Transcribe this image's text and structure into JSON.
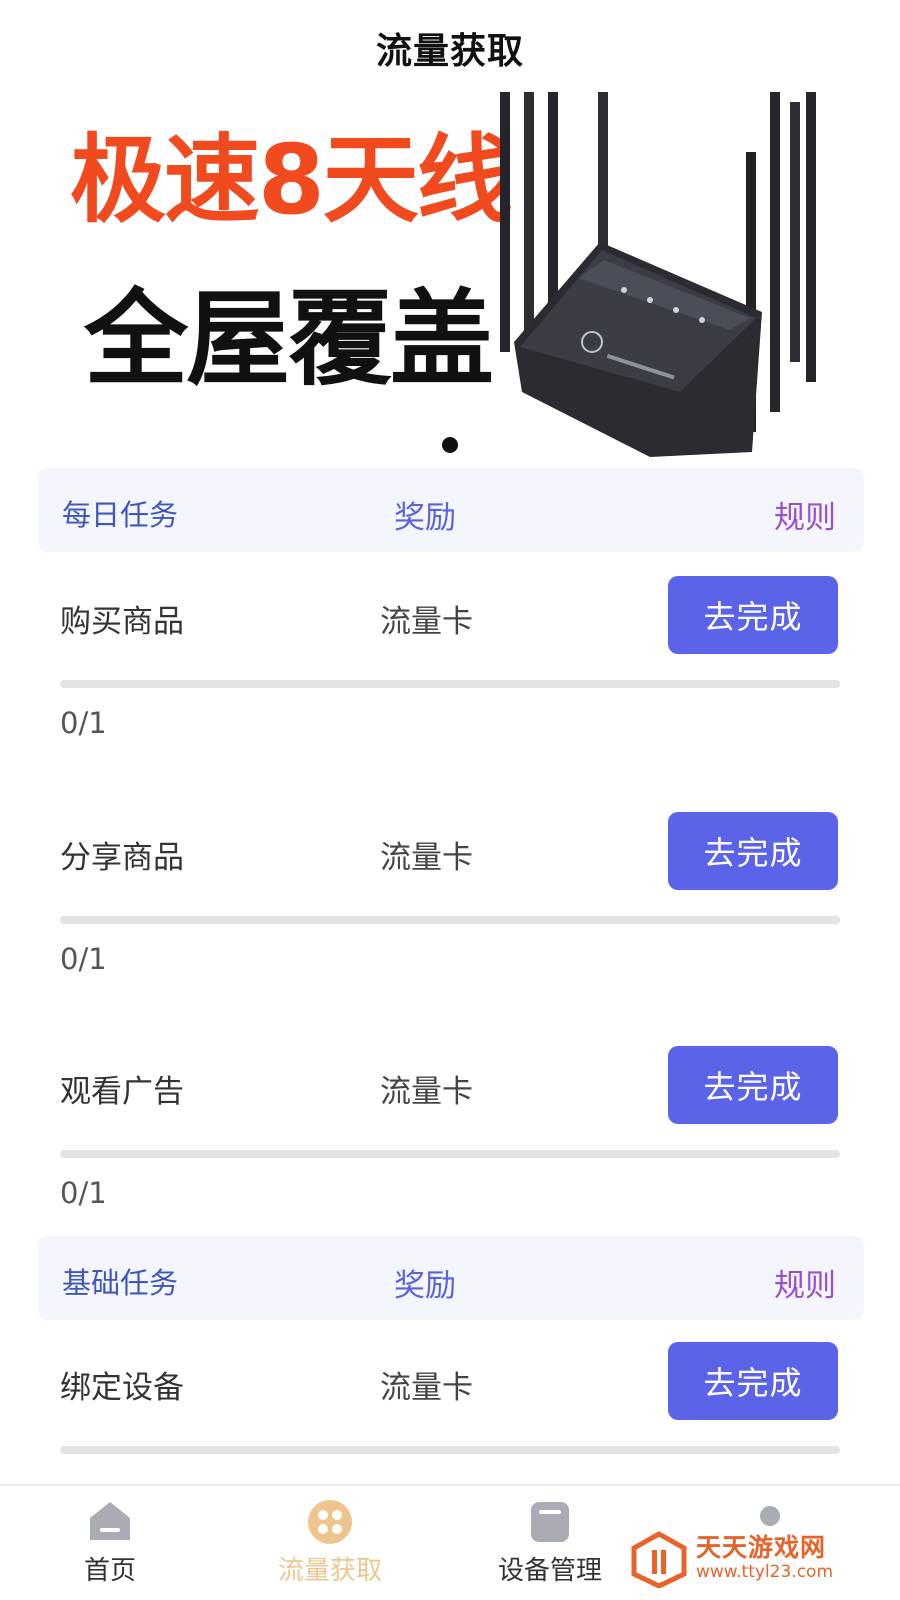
{
  "header": {
    "title": "流量获取"
  },
  "banner": {
    "line1": "极速8天线",
    "line2": "全屋覆盖",
    "active_slide": 1,
    "slide_count": 1
  },
  "sections": [
    {
      "name": "每日任务",
      "reward_header": "奖励",
      "rules_label": "规则",
      "tasks": [
        {
          "name": "购买商品",
          "reward": "流量卡",
          "button": "去完成",
          "progress": "0/1",
          "progress_value": 0
        },
        {
          "name": "分享商品",
          "reward": "流量卡",
          "button": "去完成",
          "progress": "0/1",
          "progress_value": 0
        },
        {
          "name": "观看广告",
          "reward": "流量卡",
          "button": "去完成",
          "progress": "0/1",
          "progress_value": 0
        }
      ]
    },
    {
      "name": "基础任务",
      "reward_header": "奖励",
      "rules_label": "规则",
      "tasks": [
        {
          "name": "绑定设备",
          "reward": "流量卡",
          "button": "去完成",
          "progress": "",
          "progress_value": 0
        }
      ]
    }
  ],
  "bottom_nav": {
    "items": [
      {
        "label": "首页",
        "icon": "home-icon",
        "active": false
      },
      {
        "label": "流量获取",
        "icon": "grid-icon",
        "active": true
      },
      {
        "label": "设备管理",
        "icon": "device-icon",
        "active": false
      },
      {
        "label": "",
        "icon": "profile-icon",
        "active": false
      }
    ]
  },
  "watermark": {
    "title": "天天游戏网",
    "url": "www.ttyl23.com"
  },
  "colors": {
    "primary_button": "#5b63e8",
    "active_nav": "#eec58c",
    "banner_red": "#f04a1e",
    "section_bg": "#f3f6fc"
  }
}
